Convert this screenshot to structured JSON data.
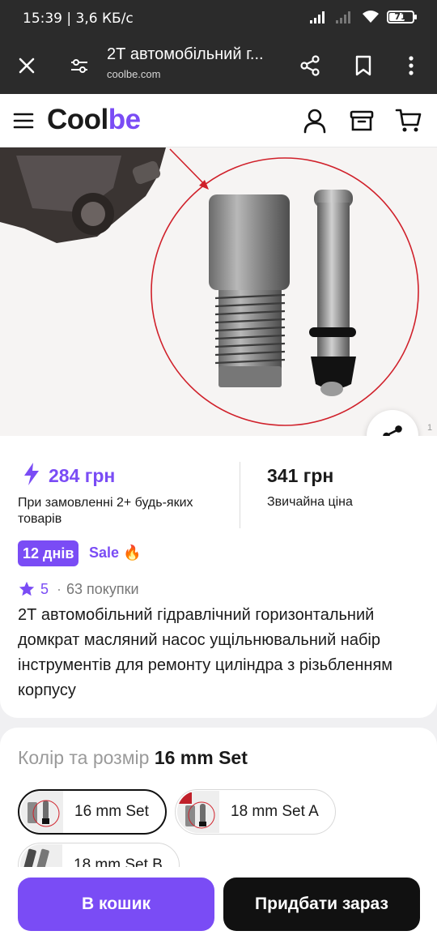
{
  "status_bar": {
    "time_info": "15:39 | 3,6 КБ/с",
    "battery": "71"
  },
  "browser": {
    "title": "2Т автомобільний г...",
    "url": "coolbe.com",
    "icons": [
      "close-icon",
      "site-settings-icon",
      "share-icon",
      "bookmark-icon",
      "more-icon"
    ]
  },
  "site": {
    "logo_part1": "Cool",
    "logo_part2": "be",
    "brand_color": "#7a4cf5",
    "icons": [
      "menu-icon",
      "account-icon",
      "orders-icon",
      "cart-icon"
    ]
  },
  "gallery": {
    "counter": "1"
  },
  "product": {
    "promo_price": "284 грн",
    "promo_text": "При замовленні 2+ будь-яких товарів",
    "regular_price": "341 грн",
    "regular_label": "Звичайна ціна",
    "days_badge": "12 днів",
    "sale_label": "Sale 🔥",
    "rating": "5",
    "separator": "·",
    "purchases": "63 покупки",
    "title": "2Т автомобільний гідравлічний горизонтальний домкрат масляний насос ущільнювальний набір інструментів для ремонту циліндра з різьбленням корпусу"
  },
  "variants": {
    "label": "Колір та розмір",
    "selected": "16 mm Set",
    "options": [
      {
        "label": "16 mm Set"
      },
      {
        "label": "18 mm Set A"
      },
      {
        "label": "18 mm Set B"
      }
    ]
  },
  "actions": {
    "add_to_cart": "В кошик",
    "buy_now": "Придбати зараз"
  }
}
